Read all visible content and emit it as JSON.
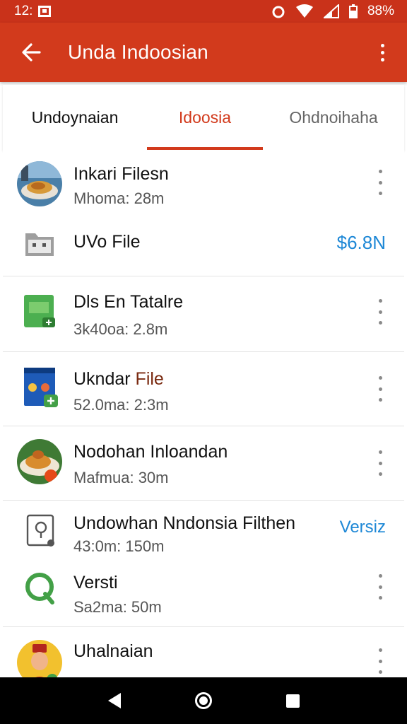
{
  "status": {
    "time": "12:",
    "battery": "88%"
  },
  "appbar": {
    "title": "Unda Indoosian",
    "back_icon": "arrow-back-icon",
    "menu_icon": "more-vert-icon"
  },
  "tabs": [
    {
      "label": "Undoynaian",
      "selected": false
    },
    {
      "label": "Idoosia",
      "selected": true
    },
    {
      "label": "Ohdnoihaha",
      "selected": false
    }
  ],
  "items": [
    {
      "title": "Inkari Filesn",
      "subtitle": "Mhoma: 28m",
      "icon": "food-photo-icon"
    },
    {
      "title": "UVo File",
      "price": "$6.8N",
      "icon": "folder-icon"
    },
    {
      "title": "Dls En Tatalre",
      "subtitle": "3k40oa: 2.8m",
      "icon": "green-app-icon"
    },
    {
      "title_main": "Ukndar",
      "title_accent": "File",
      "subtitle": "52.0ma: 2:3m",
      "icon": "blue-doc-icon"
    },
    {
      "title": "Nodohan Inloandan",
      "subtitle": "Mafmua: 30m",
      "icon": "food-photo-icon"
    },
    {
      "title": "Undowhan Nndonsia Filthen",
      "subtitle": "43:0m: 150m",
      "badge": "Versiz",
      "icon": "phone-doc-icon"
    },
    {
      "title": "Versti",
      "subtitle": "Sa2ma: 50m",
      "icon": "green-q-icon"
    },
    {
      "title": "Uhalnaian",
      "subtitle": "",
      "icon": "avatar-icon"
    }
  ],
  "colors": {
    "primary": "#d23a1c",
    "status": "#c9321a",
    "accent_blue": "#1e88d6"
  }
}
